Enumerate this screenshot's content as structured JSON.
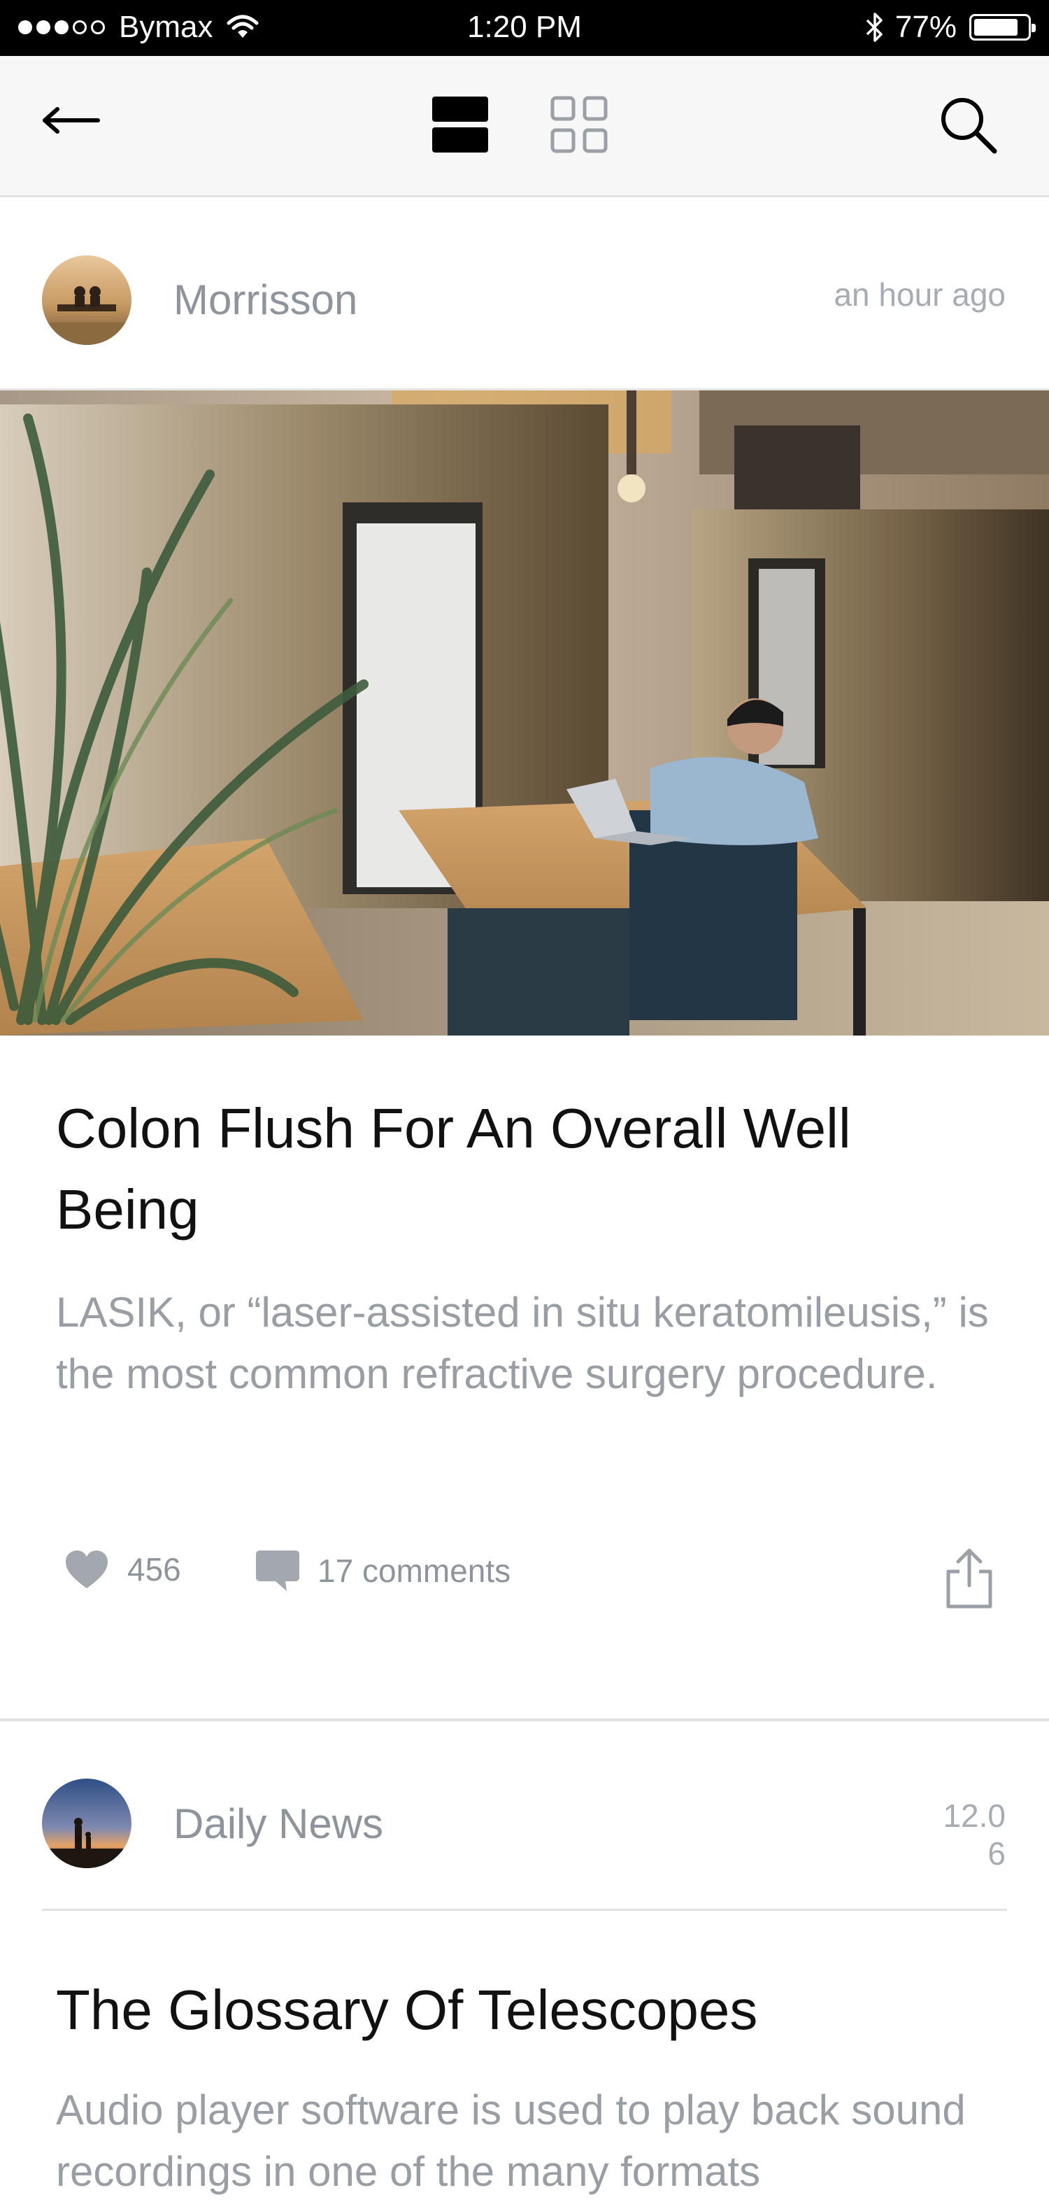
{
  "status_bar": {
    "carrier": "Bymax",
    "time": "1:20 PM",
    "battery": "77%",
    "battery_level_percent": 77,
    "signal_bars_filled": 3,
    "signal_bars_total": 5
  },
  "navbar": {
    "icons": [
      "back-arrow-icon",
      "list-view-icon",
      "grid-view-icon",
      "search-icon"
    ],
    "active_view": "list"
  },
  "posts": [
    {
      "author": "Morrisson",
      "time": "an hour ago",
      "title": "Colon Flush For An Overall Well Being",
      "excerpt": "LASIK, or “laser-assisted in situ keratomileusis,” is the most common refractive surgery procedure.",
      "likes": "456",
      "comments": "17 comments"
    },
    {
      "author": "Daily News",
      "time_line1": "12.0",
      "time_line2": "6",
      "title": "The Glossary Of Telescopes",
      "excerpt": "Audio player software is used to play back sound recordings in one of the many formats"
    }
  ],
  "colors": {
    "status_bar_bg": "#000000",
    "navbar_bg": "#f7f7f7",
    "title_text": "#111111",
    "meta_text": "#8e949b",
    "excerpt_text": "#999ea5"
  }
}
